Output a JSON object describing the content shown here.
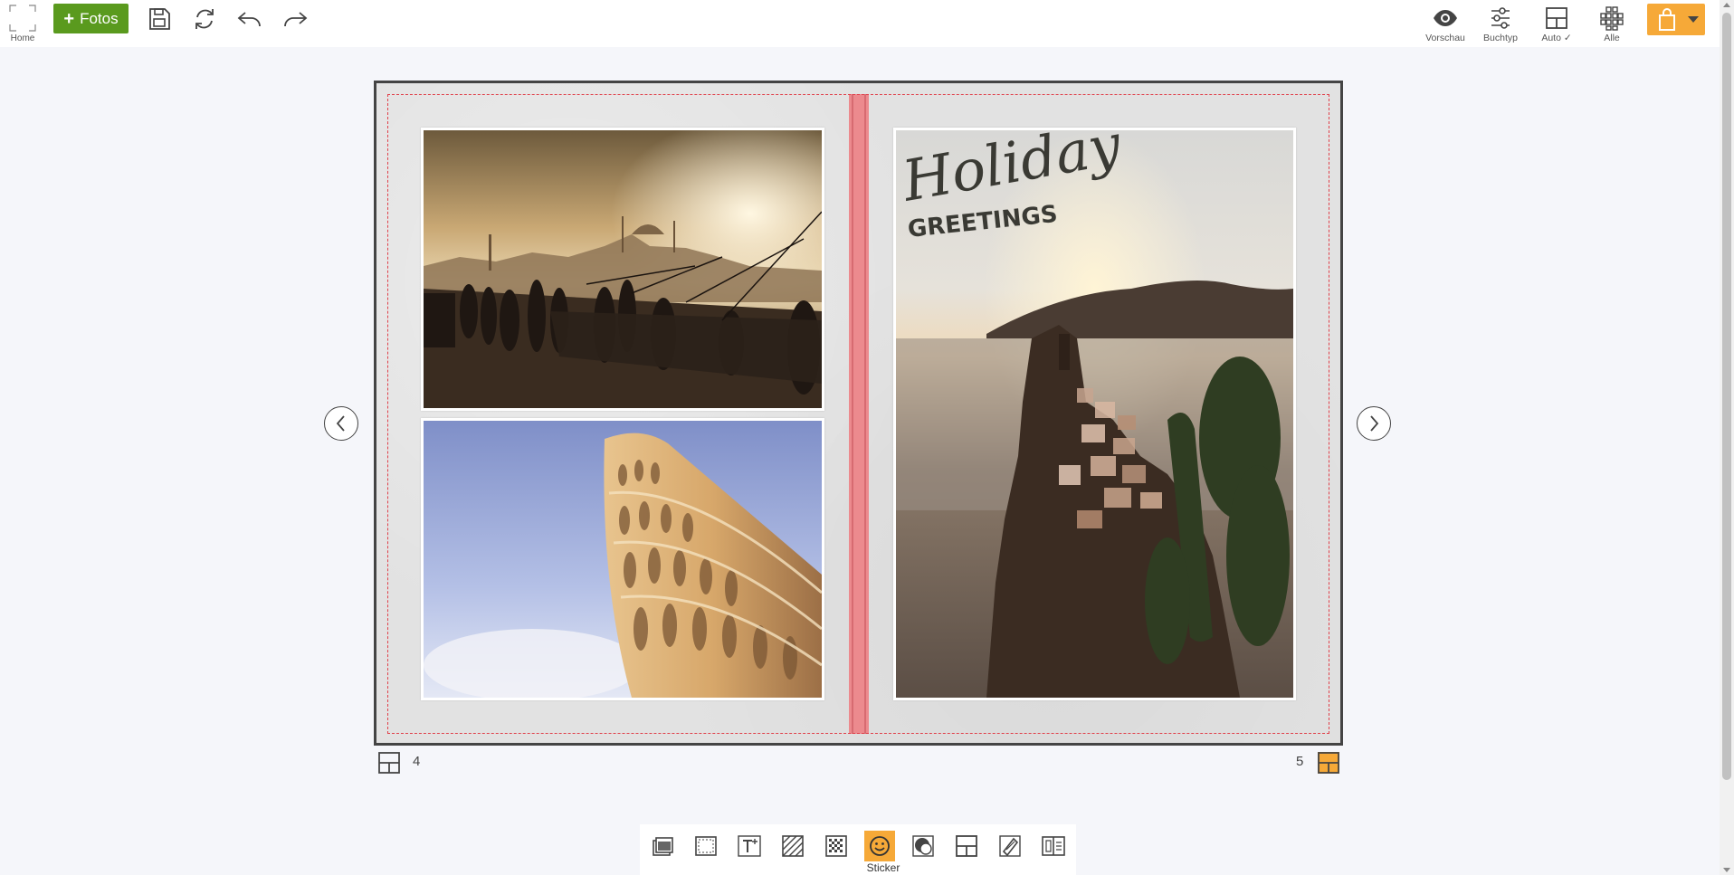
{
  "topbar": {
    "home_label": "Home",
    "fotos_label": "Fotos",
    "fotos_color": "#5a9a1e",
    "left_icons": [
      "save-icon",
      "refresh-icon",
      "undo-icon",
      "redo-icon"
    ],
    "right_tools": [
      {
        "label": "Vorschau",
        "icon": "eye-icon"
      },
      {
        "label": "Buchtyp",
        "icon": "sliders-icon"
      },
      {
        "label": "Auto ✓",
        "icon": "auto-layout-icon"
      },
      {
        "label": "Alle",
        "icon": "grid-all-icon"
      }
    ],
    "cart_color": "#f6a938"
  },
  "spread": {
    "left_page_number": "4",
    "right_page_number": "5",
    "sticker_text_line1": "Holiday",
    "sticker_text_line2": "GREETINGS",
    "photos": [
      {
        "name": "istanbul-bridge-photo"
      },
      {
        "name": "pisa-tower-photo"
      },
      {
        "name": "cinque-terre-photo"
      }
    ],
    "spine_color": "#ec8a8e",
    "bleed_color": "#e0404a"
  },
  "bottom_toolbar": {
    "tools": [
      "photo-stack-icon",
      "frame-icon",
      "text-icon",
      "background-pattern-icon",
      "texture-icon",
      "sticker-icon",
      "mask-icon",
      "layout-icon",
      "clipart-icon",
      "pages-icon"
    ],
    "active_tool": "sticker-icon",
    "active_label": "Sticker",
    "accent": "#f6a938"
  }
}
